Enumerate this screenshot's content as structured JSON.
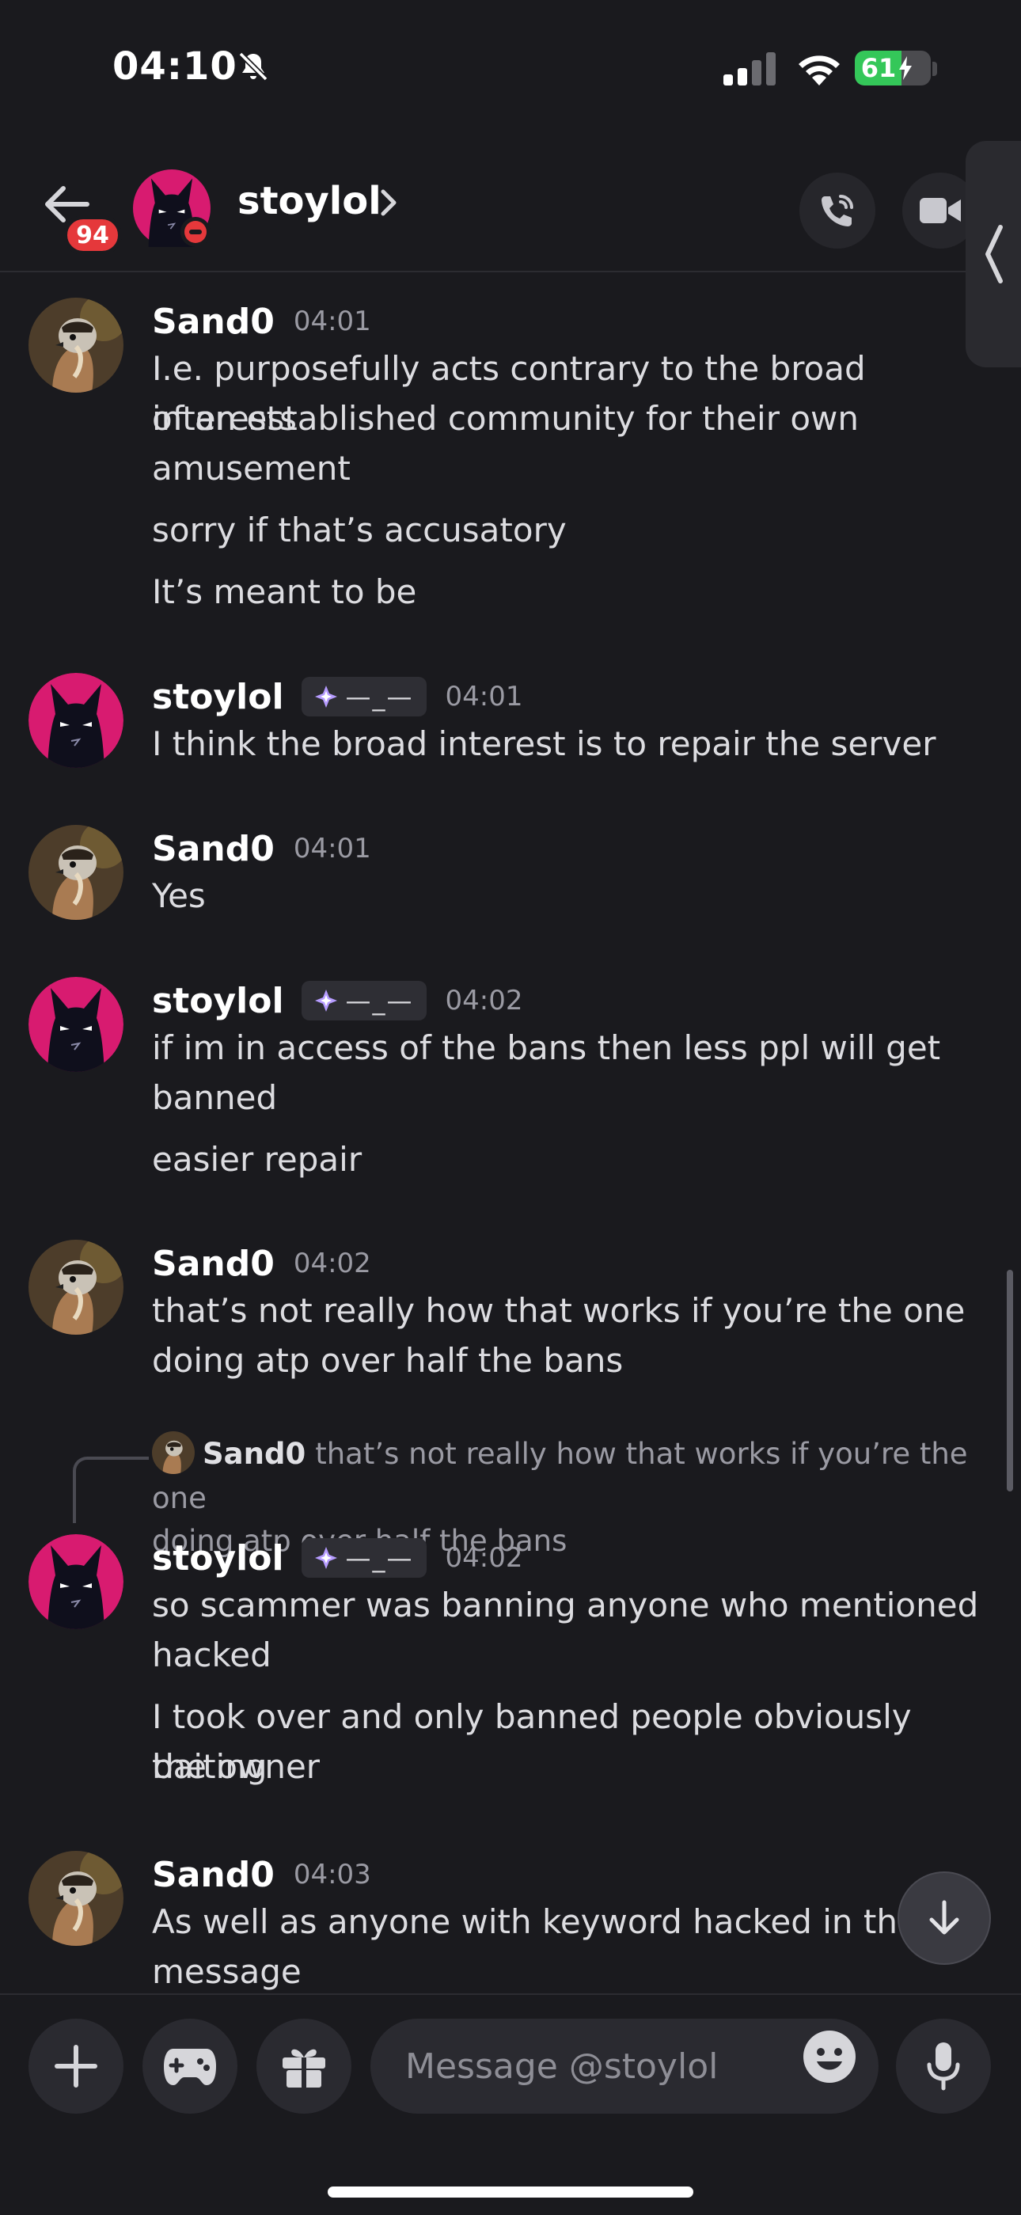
{
  "status_bar": {
    "time": "04:10",
    "battery_label": "61",
    "battery_level": 0.61,
    "icons": [
      "bell-slash-icon",
      "signal-icon",
      "wifi-icon",
      "battery-charging-icon"
    ]
  },
  "header": {
    "unread_count": "94",
    "contact_name": "stoylol",
    "status": "do-not-disturb",
    "icons": [
      "back-arrow-icon",
      "chevron-right-icon",
      "phone-call-icon",
      "video-camera-icon",
      "chevron-left-icon"
    ]
  },
  "messages": [
    {
      "author": "Sand0",
      "time": "04:01",
      "lines": [
        "I.e. purposefully acts contrary to the broad interests",
        "of an established community for their own",
        "amusement",
        "sorry if that’s accusatory",
        "It’s meant to be"
      ]
    },
    {
      "author": "stoylol",
      "tag": "—_—",
      "time": "04:01",
      "lines": [
        "I think the broad interest is to repair the server"
      ]
    },
    {
      "author": "Sand0",
      "time": "04:01",
      "lines": [
        "Yes"
      ]
    },
    {
      "author": "stoylol",
      "tag": "—_—",
      "time": "04:02",
      "lines": [
        "if im in access of the bans then less ppl will get",
        "banned",
        "easier repair"
      ]
    },
    {
      "author": "Sand0",
      "time": "04:02",
      "lines": [
        "that’s not really how that works if you’re the one",
        "doing atp over half the bans"
      ]
    },
    {
      "reply_to": {
        "author": "Sand0",
        "text_line1": "that’s not really how that works if you’re the one",
        "text_line2": "doing atp over half the bans"
      },
      "author": "stoylol",
      "tag": "—_—",
      "time": "04:02",
      "lines": [
        "so scammer was banning anyone who mentioned",
        "hacked",
        "I took over and only banned people obviously baiting",
        "the owner"
      ]
    },
    {
      "author": "Sand0",
      "time": "04:03",
      "lines": [
        "As well as anyone with keyword hacked in their",
        "message"
      ]
    }
  ],
  "composer": {
    "placeholder": "Message @stoylol",
    "icons": [
      "plus-icon",
      "gamepad-icon",
      "gift-icon",
      "emoji-icon",
      "microphone-icon"
    ]
  },
  "colors": {
    "background": "#1a1a1e",
    "accent_red": "#e5383b",
    "avatar_pink": "#d81b70",
    "battery_green": "#34c759"
  }
}
